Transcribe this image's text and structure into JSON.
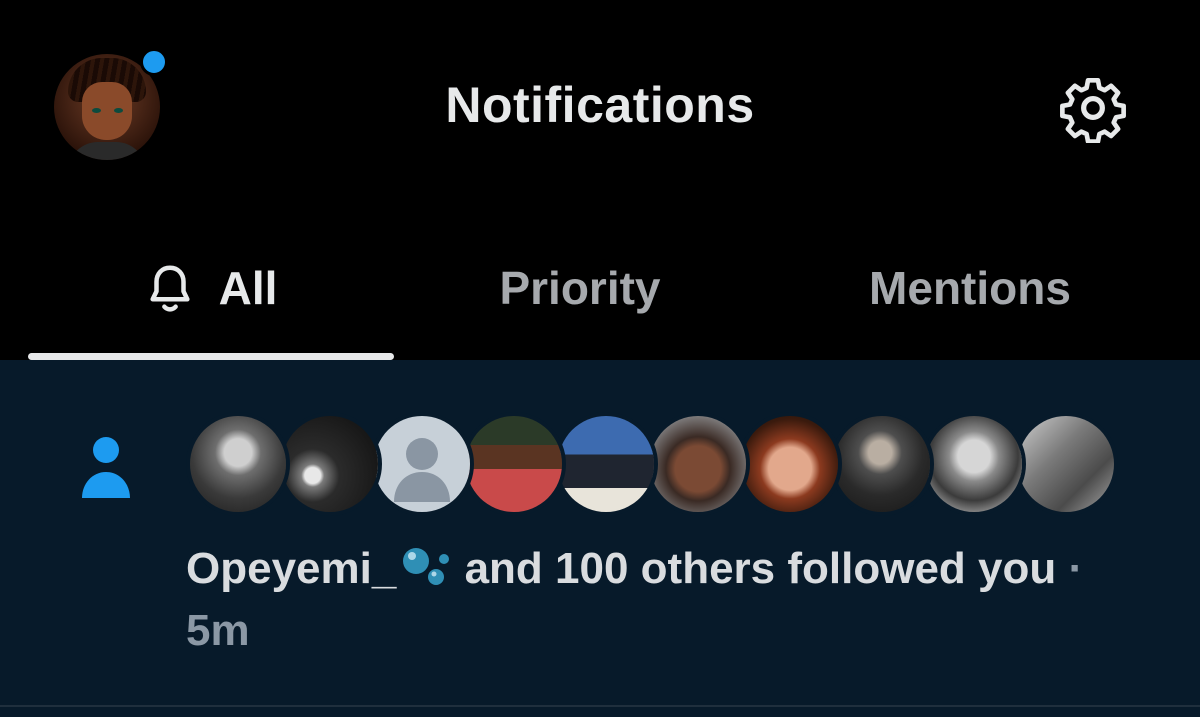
{
  "header": {
    "title": "Notifications",
    "profile_icon": "user-avatar",
    "unread_dot_color": "#1d9bf0",
    "settings_icon": "gear-icon"
  },
  "tabs": [
    {
      "label": "All",
      "icon": "bell-icon",
      "selected": true
    },
    {
      "label": "Priority",
      "selected": false
    },
    {
      "label": "Mentions",
      "selected": false
    }
  ],
  "notification": {
    "type_icon": "person-icon",
    "actor": "Opeyemi_",
    "actor_emoji": "bubbles-emoji",
    "text": "and 100 others followed you",
    "separator": "·",
    "time": "5m",
    "follower_avatars": [
      "avatar-woman-grayscale",
      "avatar-moon-tree",
      "avatar-default-silhouette",
      "avatar-man-red-shirt",
      "avatar-man-uniform",
      "avatar-girl-selfie",
      "avatar-doll",
      "avatar-man-military-salute",
      "avatar-man-grayscale",
      "avatar-abstract-grayscale"
    ]
  },
  "colors": {
    "background": "#000000",
    "feed_background": "#071a2a",
    "accent": "#1d9bf0",
    "text_primary": "#e7e9ea",
    "text_secondary": "#8b98a5"
  }
}
